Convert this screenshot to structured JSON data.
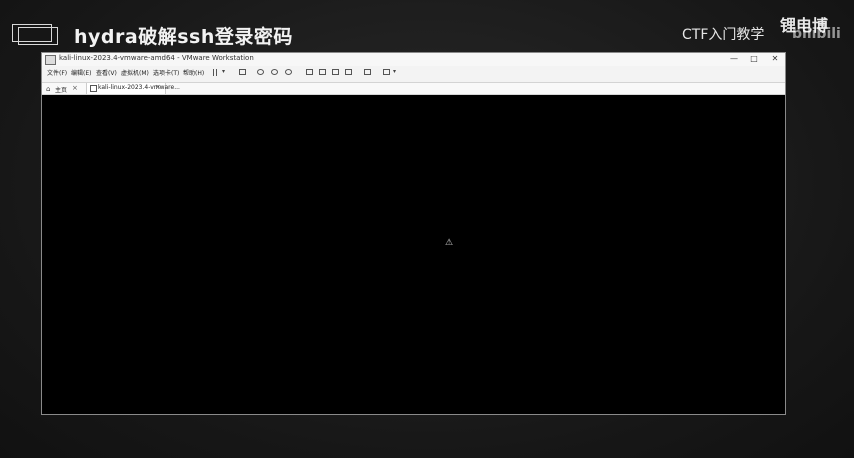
{
  "banner": {
    "title": "hydra破解ssh登录密码",
    "course_label": "CTF入门教学",
    "watermark": "锂电博",
    "watermark_logo": "bilibili"
  },
  "vm_window": {
    "title": "kali-linux-2023.4-vmware-amd64 - VMware Workstation",
    "controls": {
      "minimize": "—",
      "maximize": "□",
      "close": "✕"
    },
    "menu": [
      "文件(F)",
      "编辑(E)",
      "查看(V)",
      "虚拟机(M)",
      "选项卡(T)",
      "帮助(H)"
    ],
    "toolbar_icons": [
      "pause-icon",
      "send-keys-icon",
      "snapshot-icon",
      "revert-snapshot-icon",
      "manage-snapshots-icon",
      "view-normal-icon",
      "view-console-icon",
      "fullscreen-icon",
      "unity-icon",
      "terminal-icon",
      "stretch-icon"
    ],
    "tabs": {
      "home_label": "主页",
      "vm_tab_label": "kali-linux-2023.4-vmware...",
      "close_glyph": "×"
    },
    "cursor_glyph": "⚠"
  },
  "colors": {
    "screen": "#000000",
    "background": "#1c1c1c",
    "window_chrome": "#f3f3f3"
  }
}
